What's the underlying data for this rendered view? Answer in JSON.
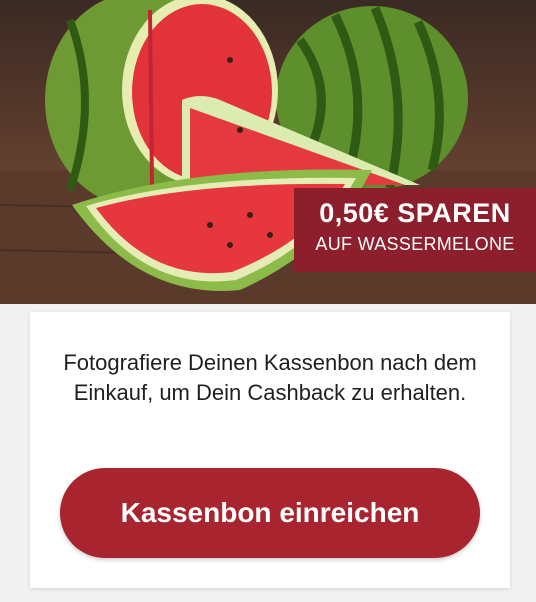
{
  "hero": {
    "image": "watermelon-photo",
    "badge": {
      "title": "0,50€ SPAREN",
      "subtitle": "AUF WASSERMELONE",
      "color": "#8d1f2c"
    }
  },
  "card": {
    "instruction": "Fotografiere Deinen Kassenbon nach dem Einkauf, um Dein Cashback zu erhalten.",
    "button_label": "Kassenbon einreichen",
    "button_color": "#a8242f"
  }
}
